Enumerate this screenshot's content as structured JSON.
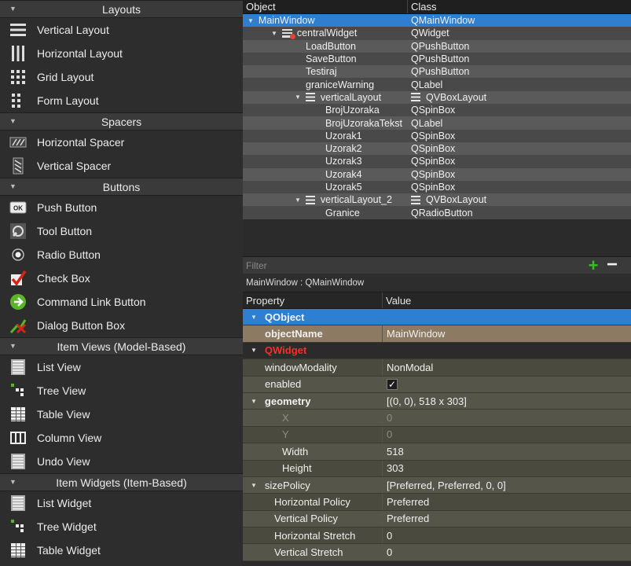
{
  "widget_box": {
    "categories": [
      {
        "label": "Layouts",
        "items": [
          {
            "label": "Vertical Layout",
            "icon": "vertical-layout-icon"
          },
          {
            "label": "Horizontal Layout",
            "icon": "horizontal-layout-icon"
          },
          {
            "label": "Grid Layout",
            "icon": "grid-layout-icon"
          },
          {
            "label": "Form Layout",
            "icon": "form-layout-icon"
          }
        ]
      },
      {
        "label": "Spacers",
        "items": [
          {
            "label": "Horizontal Spacer",
            "icon": "horizontal-spacer-icon"
          },
          {
            "label": "Vertical Spacer",
            "icon": "vertical-spacer-icon"
          }
        ]
      },
      {
        "label": "Buttons",
        "items": [
          {
            "label": "Push Button",
            "icon": "push-button-icon",
            "glyph": "OK"
          },
          {
            "label": "Tool Button",
            "icon": "tool-button-icon"
          },
          {
            "label": "Radio Button",
            "icon": "radio-button-icon"
          },
          {
            "label": "Check Box",
            "icon": "check-box-icon"
          },
          {
            "label": "Command Link Button",
            "icon": "command-link-button-icon"
          },
          {
            "label": "Dialog Button Box",
            "icon": "dialog-button-box-icon"
          }
        ]
      },
      {
        "label": "Item Views (Model-Based)",
        "items": [
          {
            "label": "List View",
            "icon": "list-view-icon"
          },
          {
            "label": "Tree View",
            "icon": "tree-view-icon"
          },
          {
            "label": "Table View",
            "icon": "table-view-icon"
          },
          {
            "label": "Column View",
            "icon": "column-view-icon"
          },
          {
            "label": "Undo View",
            "icon": "undo-view-icon"
          }
        ]
      },
      {
        "label": "Item Widgets (Item-Based)",
        "items": [
          {
            "label": "List Widget",
            "icon": "list-widget-icon"
          },
          {
            "label": "Tree Widget",
            "icon": "tree-widget-icon"
          },
          {
            "label": "Table Widget",
            "icon": "table-widget-icon"
          }
        ]
      }
    ]
  },
  "object_inspector": {
    "headers": {
      "object": "Object",
      "class": "Class"
    },
    "rows": [
      {
        "object": "MainWindow",
        "class": "QMainWindow",
        "depth": 0,
        "expanded": true,
        "selected": true
      },
      {
        "object": "centralWidget",
        "class": "QWidget",
        "depth": 1,
        "expanded": true,
        "icon": "central-widget-icon"
      },
      {
        "object": "LoadButton",
        "class": "QPushButton",
        "depth": 2
      },
      {
        "object": "SaveButton",
        "class": "QPushButton",
        "depth": 2
      },
      {
        "object": "Testiraj",
        "class": "QPushButton",
        "depth": 2
      },
      {
        "object": "graniceWarning",
        "class": "QLabel",
        "depth": 2
      },
      {
        "object": "verticalLayout",
        "class": "QVBoxLayout",
        "depth": 2,
        "expanded": true,
        "icon": "layout-icon"
      },
      {
        "object": "BrojUzoraka",
        "class": "QSpinBox",
        "depth": 3
      },
      {
        "object": "BrojUzorakaTekst",
        "class": "QLabel",
        "depth": 3
      },
      {
        "object": "Uzorak1",
        "class": "QSpinBox",
        "depth": 3
      },
      {
        "object": "Uzorak2",
        "class": "QSpinBox",
        "depth": 3
      },
      {
        "object": "Uzorak3",
        "class": "QSpinBox",
        "depth": 3
      },
      {
        "object": "Uzorak4",
        "class": "QSpinBox",
        "depth": 3
      },
      {
        "object": "Uzorak5",
        "class": "QSpinBox",
        "depth": 3
      },
      {
        "object": "verticalLayout_2",
        "class": "QVBoxLayout",
        "depth": 2,
        "expanded": true,
        "icon": "layout-icon"
      },
      {
        "object": "Granice",
        "class": "QRadioButton",
        "depth": 3
      }
    ],
    "filter_placeholder": "Filter"
  },
  "property_editor": {
    "context": "MainWindow : QMainWindow",
    "headers": {
      "property": "Property",
      "value": "Value"
    },
    "rows": [
      {
        "name": "QObject",
        "value": "",
        "kind": "group-blue"
      },
      {
        "name": "objectName",
        "value": "MainWindow",
        "kind": "objname"
      },
      {
        "name": "QWidget",
        "value": "",
        "kind": "group-red"
      },
      {
        "name": "windowModality",
        "value": "NonModal",
        "kind": "alt1"
      },
      {
        "name": "enabled",
        "value": "✓",
        "kind": "alt2",
        "checkbox": true
      },
      {
        "name": "geometry",
        "value": "[(0, 0), 518 x 303]",
        "kind": "grp",
        "expanded": true
      },
      {
        "name": "X",
        "value": "0",
        "kind": "alt2",
        "sub": true,
        "dim": true
      },
      {
        "name": "Y",
        "value": "0",
        "kind": "alt1",
        "sub": true,
        "dim": true
      },
      {
        "name": "Width",
        "value": "518",
        "kind": "alt2",
        "sub": true
      },
      {
        "name": "Height",
        "value": "303",
        "kind": "alt1",
        "sub": true
      },
      {
        "name": "sizePolicy",
        "value": "[Preferred, Preferred, 0, 0]",
        "kind": "alt2",
        "expanded": true,
        "sizepol": true
      },
      {
        "name": "Horizontal Policy",
        "value": "Preferred",
        "kind": "alt1",
        "sub2": true
      },
      {
        "name": "Vertical Policy",
        "value": "Preferred",
        "kind": "alt2",
        "sub2": true
      },
      {
        "name": "Horizontal Stretch",
        "value": "0",
        "kind": "alt1",
        "sub2": true
      },
      {
        "name": "Vertical Stretch",
        "value": "0",
        "kind": "alt2",
        "sub2": true
      }
    ]
  }
}
